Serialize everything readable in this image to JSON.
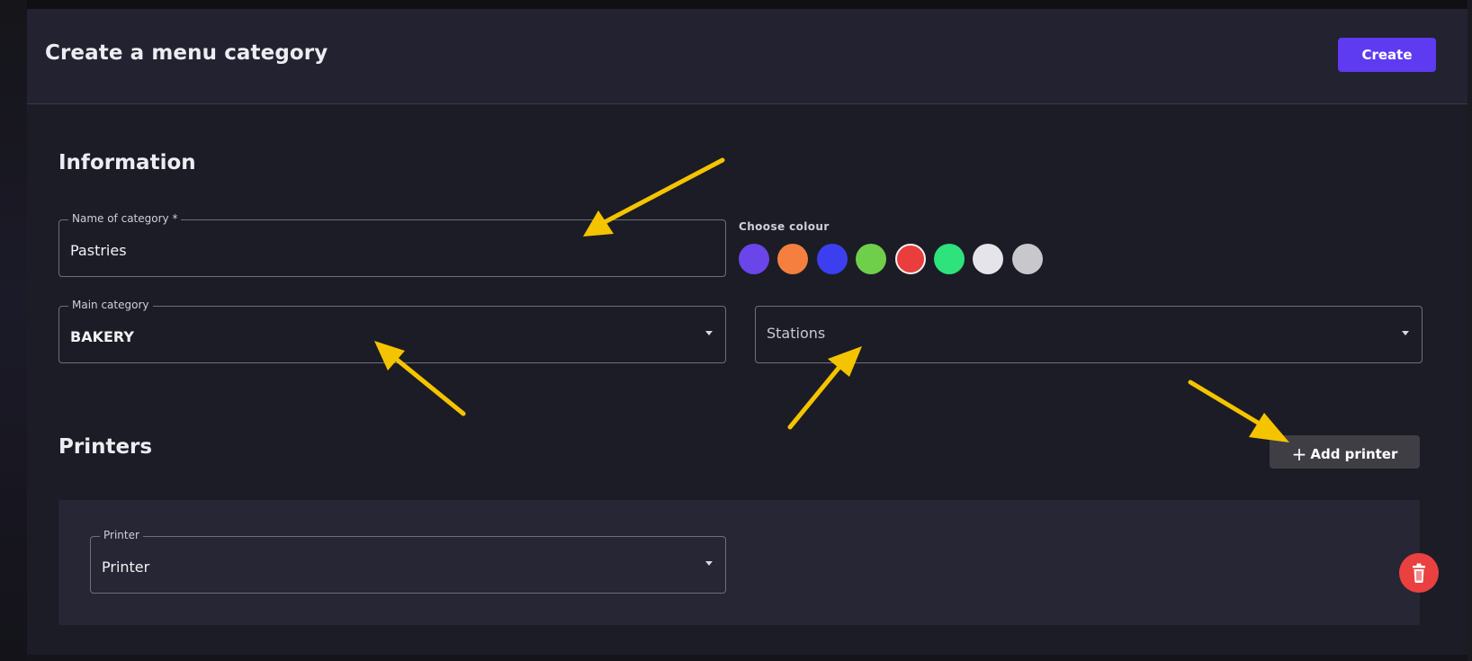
{
  "header": {
    "title": "Create a menu category",
    "create_label": "Create"
  },
  "information": {
    "section_title": "Information",
    "name_field": {
      "label": "Name of category *",
      "value": "Pastries"
    },
    "main_category": {
      "label": "Main category",
      "value": "BAKERY"
    },
    "colour": {
      "label": "Choose colour",
      "swatches": [
        "#6a45ea",
        "#f57f3e",
        "#3c3ff0",
        "#6fcf4a",
        "#ea3d3d",
        "#2ee27c",
        "#e4e4ea",
        "#c8c8cc"
      ],
      "selected": "#ea3d3d"
    },
    "stations": {
      "placeholder": "Stations"
    }
  },
  "printers": {
    "section_title": "Printers",
    "add_label": "Add printer",
    "items": [
      {
        "label": "Printer",
        "value": "Printer"
      }
    ]
  },
  "icons": {
    "add": "plus-icon",
    "dropdown": "chevron-down-icon",
    "delete": "trash-icon"
  },
  "colors": {
    "accent": "#5e3bf0",
    "danger": "#ea4040",
    "annotation": "#f5c400"
  }
}
